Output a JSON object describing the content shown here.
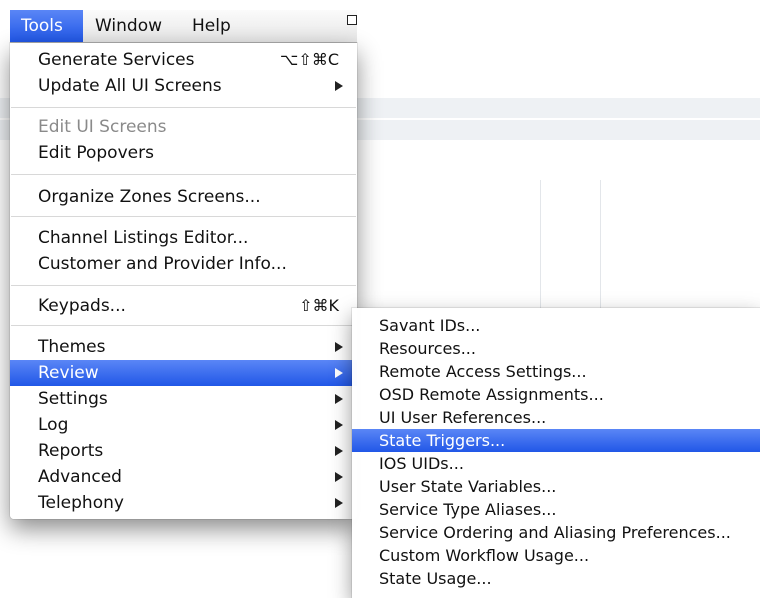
{
  "menubar": {
    "items": [
      {
        "label": "Tools",
        "active": true
      },
      {
        "label": "Window",
        "active": false
      },
      {
        "label": "Help",
        "active": false
      }
    ]
  },
  "tools_menu": {
    "items": [
      {
        "label": "Generate Services",
        "shortcut": "⌥⇧⌘C",
        "submenu": false,
        "disabled": false
      },
      {
        "label": "Update All UI Screens",
        "shortcut": "",
        "submenu": true,
        "disabled": false
      },
      {
        "label": "Edit UI Screens",
        "shortcut": "",
        "submenu": false,
        "disabled": true
      },
      {
        "label": "Edit Popovers",
        "shortcut": "",
        "submenu": false,
        "disabled": false
      },
      {
        "label": "Organize Zones Screens...",
        "shortcut": "",
        "submenu": false,
        "disabled": false
      },
      {
        "label": "Channel Listings Editor...",
        "shortcut": "",
        "submenu": false,
        "disabled": false
      },
      {
        "label": "Customer and Provider Info...",
        "shortcut": "",
        "submenu": false,
        "disabled": false
      },
      {
        "label": "Keypads...",
        "shortcut": "⇧⌘K",
        "submenu": false,
        "disabled": false
      },
      {
        "label": "Themes",
        "shortcut": "",
        "submenu": true,
        "disabled": false
      },
      {
        "label": "Review",
        "shortcut": "",
        "submenu": true,
        "disabled": false,
        "highlighted": true
      },
      {
        "label": "Settings",
        "shortcut": "",
        "submenu": true,
        "disabled": false
      },
      {
        "label": "Log",
        "shortcut": "",
        "submenu": true,
        "disabled": false
      },
      {
        "label": "Reports",
        "shortcut": "",
        "submenu": true,
        "disabled": false
      },
      {
        "label": "Advanced",
        "shortcut": "",
        "submenu": true,
        "disabled": false
      },
      {
        "label": "Telephony",
        "shortcut": "",
        "submenu": true,
        "disabled": false
      }
    ]
  },
  "review_submenu": {
    "items": [
      {
        "label": "Savant IDs..."
      },
      {
        "label": "Resources..."
      },
      {
        "label": "Remote Access Settings..."
      },
      {
        "label": "OSD Remote Assignments..."
      },
      {
        "label": "UI User References..."
      },
      {
        "label": "State Triggers...",
        "highlighted": true
      },
      {
        "label": "IOS UIDs..."
      },
      {
        "label": "User State Variables..."
      },
      {
        "label": "Service Type Aliases..."
      },
      {
        "label": "Service Ordering and Aliasing Preferences..."
      },
      {
        "label": "Custom Workflow Usage..."
      },
      {
        "label": "State Usage..."
      }
    ]
  },
  "colors": {
    "highlight": "#2f66ee",
    "disabled_text": "#8a8a8a"
  }
}
